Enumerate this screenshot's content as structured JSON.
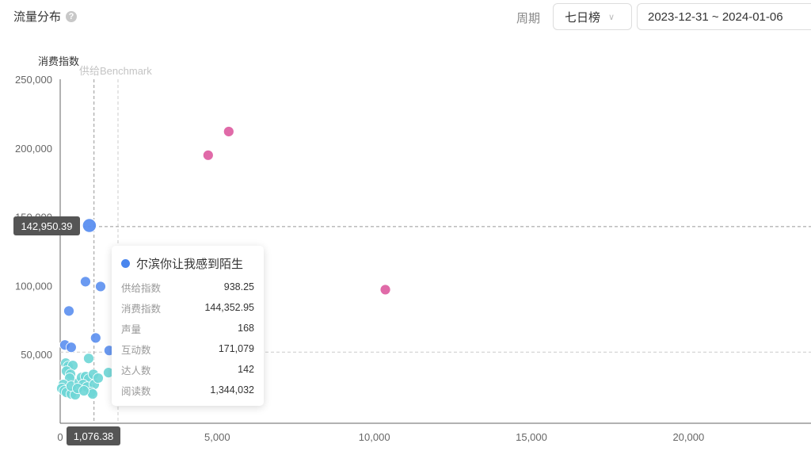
{
  "header": {
    "title": "流量分布",
    "help_icon": "?",
    "period_label": "周期",
    "period_value": "七日榜",
    "date_range": "2023-12-31 ~ 2024-01-06"
  },
  "chart_data": {
    "type": "scatter",
    "xlabel": "",
    "ylabel": "消费指数",
    "xlim": [
      0,
      24000
    ],
    "ylim": [
      0,
      250000
    ],
    "x_ticks": [
      "0",
      "5,000",
      "10,000",
      "15,000",
      "20,000"
    ],
    "y_ticks": [
      "50,000",
      "100,000",
      "150,000",
      "200,000",
      "250,000"
    ],
    "x_tick_values": [
      0,
      5000,
      10000,
      15000,
      20000
    ],
    "y_tick_values": [
      50000,
      100000,
      150000,
      200000,
      250000
    ],
    "benchmarks": {
      "supply_label": "供给Benchmark",
      "supply_x": 1840,
      "consumption_y": 51700
    },
    "crosshair": {
      "x": 1076.38,
      "y": 142950.39,
      "x_label": "1,076.38",
      "y_label": "142,950.39"
    },
    "colors": {
      "pink": "#dd5a9f",
      "blue": "#5b8ff0",
      "cyan": "#6ed6d6"
    },
    "groups": [
      {
        "color": "#dd5a9f",
        "points": [
          [
            4710,
            194800
          ],
          [
            5365,
            212000
          ],
          [
            10350,
            97100
          ]
        ]
      },
      {
        "color": "#5b8ff0",
        "points": [
          [
            930,
            143700
          ],
          [
            805,
            102900
          ],
          [
            1285,
            99400
          ],
          [
            277,
            81600
          ],
          [
            150,
            56900
          ],
          [
            350,
            55200
          ],
          [
            1130,
            62000
          ],
          [
            1560,
            52900
          ]
        ]
      },
      {
        "color": "#6ed6d6",
        "points": [
          [
            176,
            43700
          ],
          [
            252,
            41400
          ],
          [
            403,
            42000
          ],
          [
            202,
            37900
          ],
          [
            328,
            35600
          ],
          [
            302,
            32800
          ],
          [
            907,
            47100
          ],
          [
            101,
            28200
          ],
          [
            50,
            25300
          ],
          [
            126,
            23600
          ],
          [
            202,
            22400
          ],
          [
            353,
            21300
          ],
          [
            479,
            20700
          ],
          [
            353,
            27000
          ],
          [
            605,
            29900
          ],
          [
            680,
            33300
          ],
          [
            806,
            33900
          ],
          [
            907,
            32200
          ],
          [
            1058,
            35600
          ],
          [
            731,
            28200
          ],
          [
            857,
            26400
          ],
          [
            1084,
            28200
          ],
          [
            1210,
            32800
          ],
          [
            1537,
            36800
          ],
          [
            983,
            22400
          ],
          [
            554,
            25300
          ],
          [
            1033,
            21300
          ],
          [
            756,
            23600
          ]
        ]
      }
    ],
    "highlighted_point": [
      930,
      143700
    ]
  },
  "tooltip": {
    "name": "尔滨你让我感到陌生",
    "rows": [
      {
        "k": "供给指数",
        "v": "938.25"
      },
      {
        "k": "消费指数",
        "v": "144,352.95"
      },
      {
        "k": "声量",
        "v": "168"
      },
      {
        "k": "互动数",
        "v": "171,079"
      },
      {
        "k": "达人数",
        "v": "142"
      },
      {
        "k": "阅读数",
        "v": "1,344,032"
      }
    ]
  }
}
